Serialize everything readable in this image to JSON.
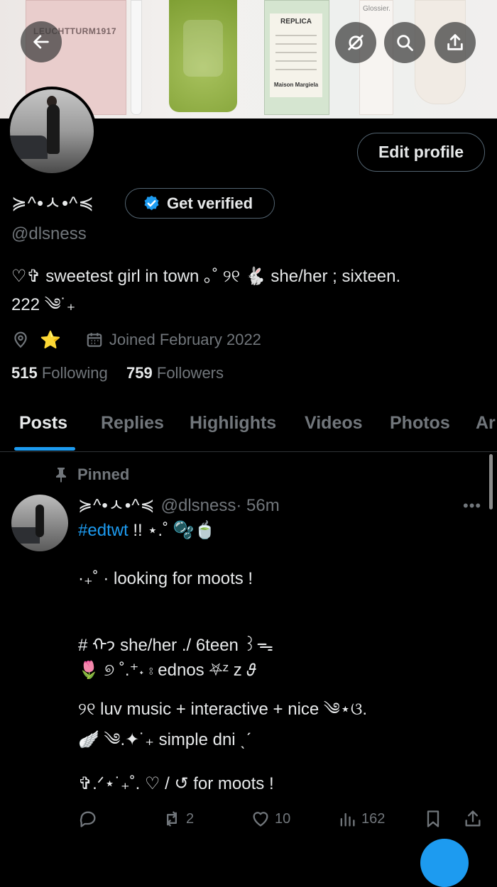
{
  "banner": {
    "notebook_brand": "LEUCHTTURM1917",
    "perfume_brand": "REPLICA",
    "perfume_maker": "Maison Margiela",
    "tube_brand": "Glossier."
  },
  "top_buttons": {
    "back": "back-arrow-icon",
    "hide": "eye-slash-icon",
    "search": "search-icon",
    "share": "share-icon"
  },
  "profile": {
    "edit_label": "Edit profile",
    "display_name": "≽^•ㅅ•^≼",
    "verify_label": "Get verified",
    "handle": "@dlsness",
    "bio_line1": "♡✞ sweetest girl in town ｡˚ ୨୧ 🐇 she/her ; sixteen.",
    "bio_line2": "222 ༄˙₊",
    "location": "⭐",
    "joined": "Joined February 2022",
    "following_count": "515",
    "following_label": "Following",
    "followers_count": "759",
    "followers_label": "Followers"
  },
  "tabs": [
    {
      "label": "Posts"
    },
    {
      "label": "Replies"
    },
    {
      "label": "Highlights"
    },
    {
      "label": "Videos"
    },
    {
      "label": "Photos"
    },
    {
      "label": "Ar"
    }
  ],
  "tweet": {
    "pinned_label": "Pinned",
    "author_name": "≽^•ㅅ•^≼",
    "author_handle": "@dlsness",
    "time": "· 56m",
    "hashtag": "#edtwt",
    "after_hashtag": " !! ⋆.˚ 🫧🍵",
    "lines": [
      "·₊˚ · looking for moots !",
      "# ᡣ𐭩 she/her ./ 6teen ꒱ᯓ",
      "    🌷  ୭ ˚.⁺˖ ⦂ ednos ⛧ᶻ z 𝜗",
      "୨୧ luv music + interactive + nice ༄⋆ଓ.",
      "    🪽  ༄.✦˙₊ simple dni ˎˊ",
      "✞.ᐟ⋆˙₊˚. ♡ / ↺ for moots !"
    ],
    "reply_count": "",
    "retweet_count": "2",
    "like_count": "10",
    "view_count": "162"
  }
}
